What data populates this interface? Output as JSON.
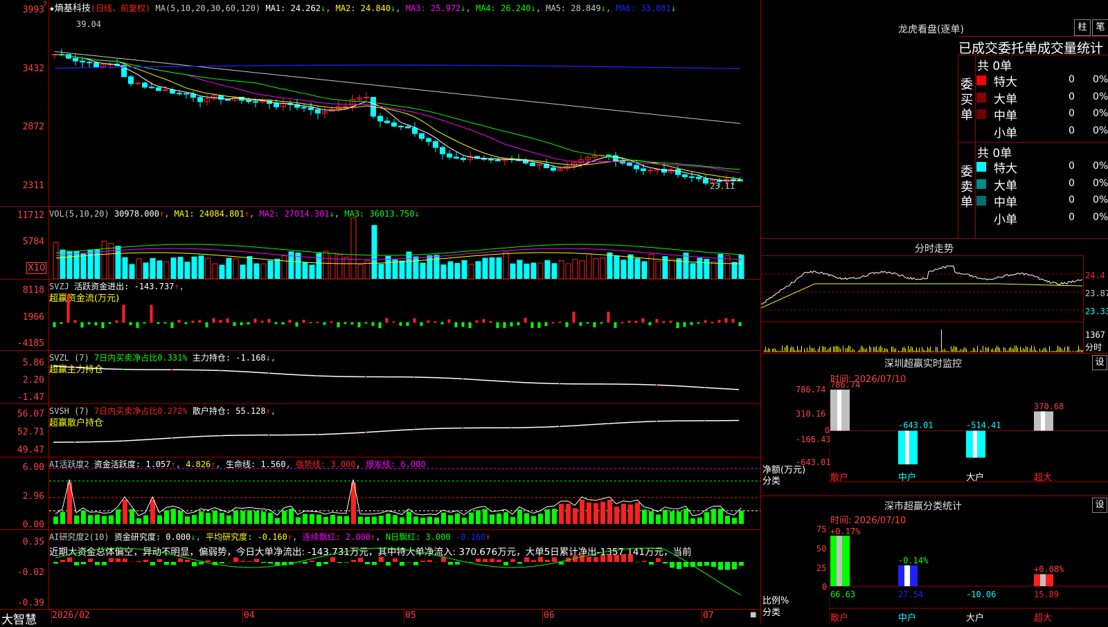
{
  "colors": {
    "up": "#ff2020",
    "down": "#00ffff",
    "ma1": "#ffffff",
    "ma2": "#ffff00",
    "ma3": "#ff00ff",
    "ma4": "#00ff00",
    "ma5": "#c8c8c8",
    "ma6": "#2020ff",
    "grid": "#a00000"
  },
  "kline": {
    "title": "★熵基科技",
    "period": "(日线，前复权)",
    "ma_label": "MA(5,10,20,30,60,120)",
    "ma1": "MA1: 24.262",
    "ma2": "MA2: 24.840",
    "ma3": "MA3: 25.972",
    "ma4": "MA4: 26.240",
    "ma5": "MA5: 28.849",
    "ma6": "MA6: 33.081",
    "y_labels": [
      "3993",
      "3432",
      "2872",
      "2311"
    ],
    "high_mark": "39.04",
    "low_mark": "23.11"
  },
  "vol": {
    "header": "VOL(5,10,20)",
    "value": "30978.000",
    "ma1": "MA1: 24084.801",
    "ma2": "MA2: 27014.301",
    "ma3": "MA3: 36013.750",
    "y_labels": [
      "11712",
      "5784"
    ],
    "unit": "X10"
  },
  "svzj": {
    "header": "SVZJ",
    "label": "活跃资金进出: -143.737",
    "sub": "超赢资金流(万元)",
    "y_labels": [
      "8118",
      "1966",
      "-4185"
    ]
  },
  "svzl": {
    "header": "SVZL (7)",
    "ratio": "7日内买卖净占比0.331%",
    "label": "主力持仓: -1.168",
    "sub": "超赢主力持仓",
    "y_labels": [
      "5.86",
      "2.20",
      "-1.47"
    ]
  },
  "svsh": {
    "header": "SVSH (7)",
    "ratio": "7日内买卖净占比0.272%",
    "label": "散户持仓: 55.128",
    "sub": "超赢散户持仓",
    "y_labels": [
      "56.07",
      "52.71",
      "49.47"
    ]
  },
  "ai1": {
    "header": "AI活跃度2",
    "a": "资金活跃度: 1.057",
    "b": "4.826",
    "c": "生命线: 1.560",
    "d": "强势线: 3.000",
    "e": "爆发线: 6.000",
    "y_labels": [
      "6.00",
      "2.96",
      "0.00"
    ]
  },
  "ai2": {
    "header": "AI研究度2(10)",
    "a": "资金研究度: 0.000",
    "b": "平均研究度: -0.160",
    "c": "连续飘红: 2.000",
    "d": "N日飘红: 3.000",
    "e": "-0.160",
    "y_labels": [
      "0.35",
      "-0.02",
      "-0.39"
    ],
    "comment": "近期大资金总体偏空，异动不明显，偏弱势，今日大单净流出: -143.731万元，其中特大单净流入: 370.676万元，大单5日累计净出-1357.141万元，当前"
  },
  "xaxis": {
    "labels": [
      "2026/02",
      "04",
      "05",
      "06",
      "07"
    ]
  },
  "brand": "大智慧",
  "lhb": {
    "title": "龙虎看盘(逐单)",
    "btn1": "柱",
    "btn2": "笔",
    "heading": "已成交委托单成交量统计",
    "buy": {
      "label": "委买单",
      "total": "共 0单",
      "rows": [
        {
          "name": "特大",
          "count": "0",
          "pct": "0%"
        },
        {
          "name": "大单",
          "count": "0",
          "pct": "0%"
        },
        {
          "name": "中单",
          "count": "0",
          "pct": "0%"
        },
        {
          "name": "小单",
          "count": "0",
          "pct": "0%"
        }
      ]
    },
    "sell": {
      "label": "委卖单",
      "total": "共 0单",
      "rows": [
        {
          "name": "特大",
          "count": "0",
          "pct": "0%"
        },
        {
          "name": "大单",
          "count": "0",
          "pct": "0%"
        },
        {
          "name": "中单",
          "count": "0",
          "pct": "0%"
        },
        {
          "name": "小单",
          "count": "0",
          "pct": "0%"
        }
      ]
    }
  },
  "fenshi": {
    "title": "分时走势",
    "y_labels": [
      "24.4",
      "23.87",
      "23.33"
    ],
    "vol_label": "1367",
    "vol_unit": "分时"
  },
  "monitor": {
    "title": "深圳超赢实时监控",
    "btn": "设",
    "time": "时间: 2026/07/10",
    "y_labels": [
      "786.74",
      "310.16",
      "0",
      "-166.43",
      "-643.01"
    ],
    "ylabel1": "净额(万元)",
    "ylabel2": "分类",
    "chart_data": {
      "type": "bar",
      "categories": [
        "散户",
        "中户",
        "大户",
        "超大"
      ],
      "values": [
        786.74,
        -643.01,
        -514.41,
        370.68
      ],
      "ylim": [
        -643.01,
        786.74
      ]
    },
    "value_labels": [
      "786.74",
      "-643.01",
      "-514.41",
      "370.68"
    ]
  },
  "stats": {
    "title": "深市超赢分类统计",
    "btn": "设",
    "time": "时间: 2026/07/10",
    "y_labels": [
      "75",
      "50",
      "25",
      "0"
    ],
    "ylabel1": "比例%",
    "ylabel2": "分类",
    "chart_data": {
      "type": "bar",
      "categories": [
        "散户",
        "中户",
        "大户",
        "超大"
      ],
      "values": [
        66.63,
        27.54,
        -10.06,
        15.89
      ],
      "ylim": [
        0,
        75
      ]
    },
    "top_labels": [
      "+0.17%",
      "-0.14%",
      "+0.08%"
    ],
    "bottom_labels": [
      "66.63",
      "27.54",
      "-10.06",
      "15.89"
    ]
  }
}
